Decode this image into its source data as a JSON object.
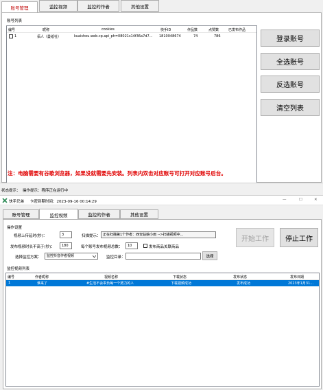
{
  "top": {
    "tabs": [
      "账号管理",
      "监控视频",
      "监控的作者",
      "其他设置"
    ],
    "list_title": "账号列表",
    "columns": [
      "编号",
      "昵称",
      "cookies",
      "快手ID",
      "作品数",
      "点赞数",
      "已发布作品"
    ],
    "rows": [
      {
        "id": "1",
        "nickname": "佰人（曼纸社）",
        "cookies": "kuaishou.web.cp.api_ph=08021s14f36a7d7...",
        "ks_id": "1810048674",
        "works": "74",
        "likes": "786",
        "published": ""
      }
    ],
    "buttons": [
      "登录账号",
      "全选账号",
      "反选账号",
      "清空列表"
    ],
    "notice": "注：电脑需要有谷歌浏览器，如果没就需要先安装。列表内双击对应账号可打开对应账号后台。"
  },
  "status": {
    "label": "状态提示：",
    "text": "操作提示：程序正在运行中"
  },
  "window": {
    "title": "快手兄弟",
    "subtitle": "卡密到期时间：2023-09-16 00:14:29",
    "controls": [
      "—",
      "☐",
      "✕"
    ]
  },
  "bottom": {
    "tabs": [
      "账号管理",
      "监控视频",
      "监控的作者",
      "其他设置"
    ],
    "group_title": "操作设置",
    "interval_label": "视频上传延时(秒)：",
    "interval_value": "3",
    "scan_label": "扫描提示：",
    "scan_value": "正在扫描第1个作者：西安姑娘小雨 -->扫描视频中...",
    "max_len_label": "发布视频时长不高于(秒)：",
    "max_len_value": "180",
    "per_account_label": "每个账号发布视频总数：",
    "per_account_value": "10",
    "product_label": "发布商品关联商品",
    "scheme_label": "选择监控方案：",
    "scheme_value": "监控抖音作者视频",
    "dir_label": "监控目录：",
    "dir_value": "",
    "select_button": "选择",
    "start_button": "开始工作",
    "stop_button": "停止工作",
    "list_title": "监控视频列表",
    "columns": [
      "编号",
      "作者昵称",
      "视频名称",
      "下载状态",
      "发布状态",
      "发布日期"
    ],
    "rows": [
      {
        "id": "1",
        "author": "谁来了",
        "video": "#生活不会辜负每一个努力的人",
        "download": "下载视频成功",
        "publish": "发布成功",
        "date": "2023年1月31..."
      }
    ]
  }
}
